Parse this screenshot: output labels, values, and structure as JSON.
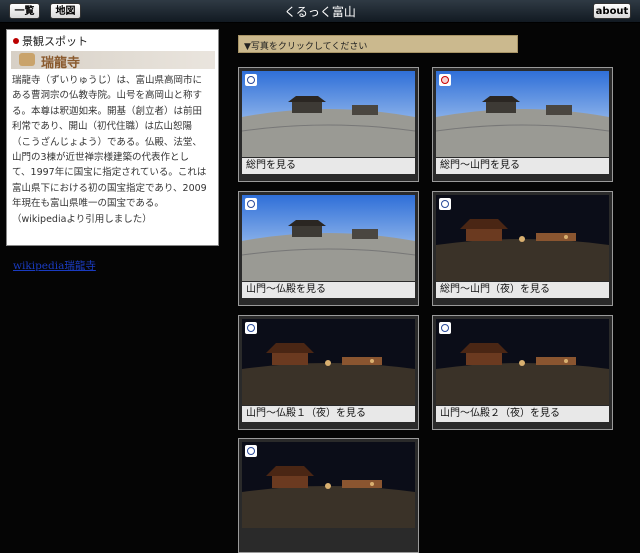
{
  "header": {
    "title": "くるっく富山",
    "list_button": "一覧",
    "map_button": "地図",
    "about_button": "about"
  },
  "sidebar": {
    "category": "景観スポット",
    "spot_name": "瑞龍寺",
    "description_lines": [
      "瑞龍寺（ずいりゅうじ）は、富山県高岡市に",
      "ある曹洞宗の仏教寺院。山号を高岡山と称す",
      "る。本尊は釈迦如来。開基（創立者）は前田",
      "利常であり、開山（初代住職）は広山恕陽",
      "（こうざんじょよう）である。仏殿、法堂、",
      "山門の3棟が近世禅宗様建築の代表作とし",
      "て、1997年に国宝に指定されている。これは",
      "富山県下における初の国宝指定であり、2009",
      "年現在も富山県唯一の国宝である。",
      "（wikipediaより引用しました）"
    ],
    "wiki_link": "wikipedia瑞龍寺"
  },
  "hint": "▼写真をクリックしてください",
  "photos": [
    {
      "caption": "総門を見る",
      "scene": "day"
    },
    {
      "caption": "総門〜山門を見る",
      "scene": "day"
    },
    {
      "caption": "山門〜仏殿を見る",
      "scene": "day"
    },
    {
      "caption": "総門〜山門（夜）を見る",
      "scene": "night"
    },
    {
      "caption": "山門〜仏殿１（夜）を見る",
      "scene": "night"
    },
    {
      "caption": "山門〜仏殿２（夜）を見る",
      "scene": "night"
    },
    {
      "caption": "",
      "scene": "night"
    }
  ],
  "colors": {
    "background": "#050505",
    "accent_dot": "#bb0000",
    "link": "#1a3bc0"
  }
}
